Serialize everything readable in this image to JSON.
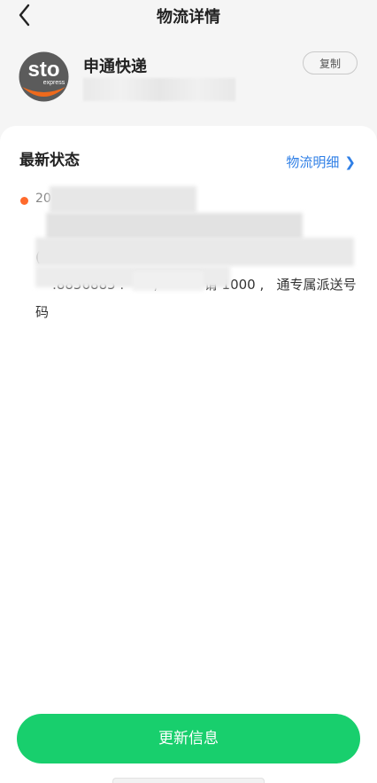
{
  "nav": {
    "title": "物流详情",
    "back_icon": "chevron-left-icon"
  },
  "courier": {
    "name": "申通快递",
    "logo_text": "sto",
    "logo_sub": "express",
    "copy_label": "复制",
    "logo_colors": {
      "disk": "#5b5b5b",
      "accent": "#ef6a1c"
    }
  },
  "latest": {
    "title": "最新状态",
    "detail_link": "物流明细",
    "time": "20",
    "text": "                                          快递员\n(                                                     \n    .8856885 .       ,           请 1000 ,   通专属派送号\n码",
    "dot_color": "#ff6a2c"
  },
  "update_button": {
    "label": "更新信息",
    "color": "#18cf6d"
  }
}
